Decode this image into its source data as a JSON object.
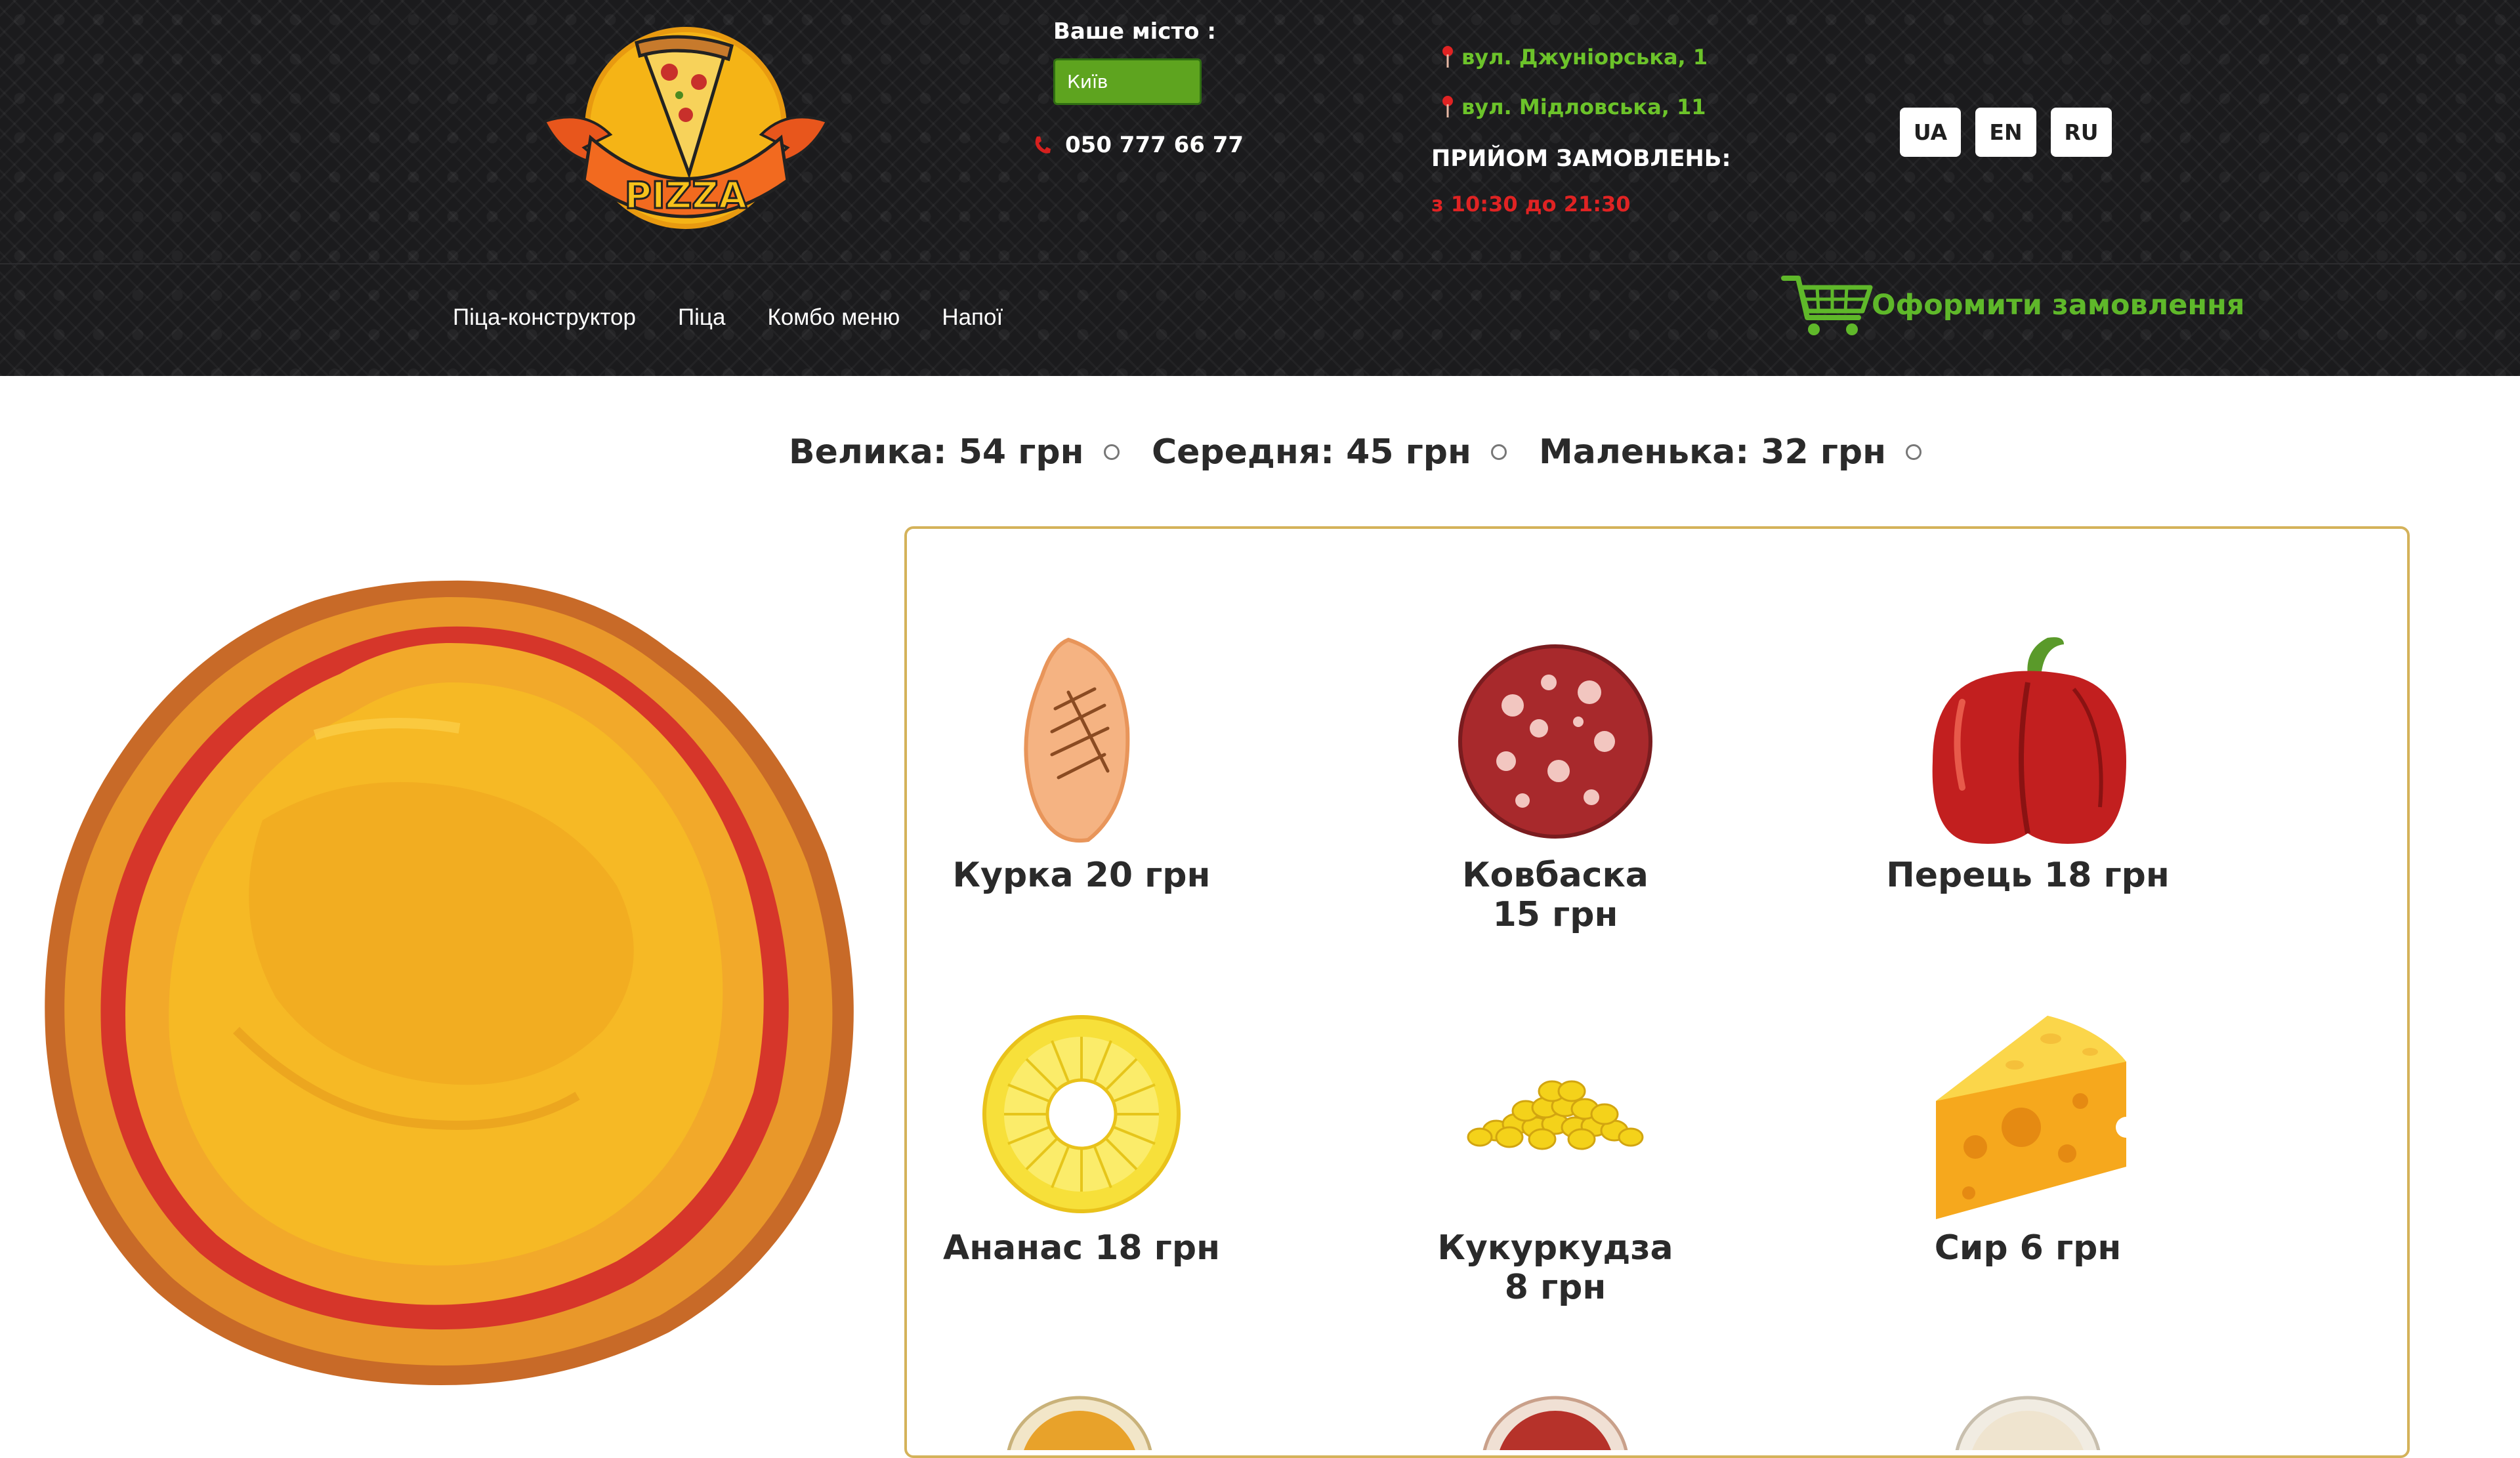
{
  "header": {
    "logo_text": "PIZZA",
    "city": {
      "label": "Ваше місто :",
      "selected": "Київ"
    },
    "phone": "050 777 66 77",
    "addresses": [
      "вул. Джуніорська, 1",
      "вул. Мідловська, 11"
    ],
    "hours_label": "ПРИЙОМ ЗАМОВЛЕНЬ:",
    "hours": "з 10:30 до 21:30",
    "languages": [
      "UA",
      "EN",
      "RU"
    ]
  },
  "nav": {
    "items": [
      "Піца-конструктор",
      "Піца",
      "Комбо меню",
      "Напої"
    ],
    "cart_label": "Оформити замовлення"
  },
  "sizes": [
    {
      "label": "Велика: 54 грн",
      "selected": false
    },
    {
      "label": "Середня: 45 грн",
      "selected": false
    },
    {
      "label": "Маленька: 32 грн",
      "selected": false
    }
  ],
  "ingredients": [
    {
      "line1": "Курка 20 грн",
      "line2": "",
      "icon": "chicken-icon"
    },
    {
      "line1": "Ковбаска",
      "line2": "15 грн",
      "icon": "sausage-icon"
    },
    {
      "line1": "Перець 18 грн",
      "line2": "",
      "icon": "pepper-icon"
    },
    {
      "line1": "Ананас 18 грн",
      "line2": "",
      "icon": "pineapple-icon"
    },
    {
      "line1": "Кукуркудза",
      "line2": "8 грн",
      "icon": "corn-icon"
    },
    {
      "line1": "Сир 6 грн",
      "line2": "",
      "icon": "cheese-icon"
    }
  ],
  "colors": {
    "header_bg": "#1b1b1d",
    "accent_green": "#5fb82a",
    "hours_red": "#e02323",
    "panel_border": "#d4b25a"
  }
}
